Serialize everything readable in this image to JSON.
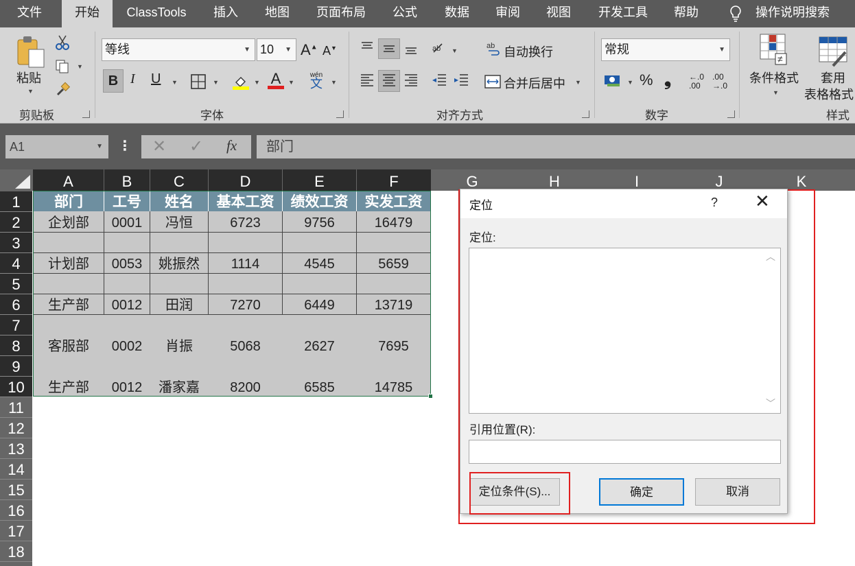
{
  "tabs": [
    "文件",
    "开始",
    "ClassTools",
    "插入",
    "地图",
    "页面布局",
    "公式",
    "数据",
    "审阅",
    "视图",
    "开发工具",
    "帮助"
  ],
  "tell_me": "操作说明搜索",
  "ribbon": {
    "clipboard": {
      "paste": "粘贴",
      "label": "剪贴板"
    },
    "font": {
      "name": "等线",
      "size": "10",
      "bold": "B",
      "italic": "I",
      "underline": "U",
      "phonetic_top": "wén",
      "phonetic_bottom": "文",
      "label": "字体",
      "grow": "A",
      "shrink": "A",
      "color_letter": "A"
    },
    "alignment": {
      "wrap": "自动换行",
      "merge": "合并后居中",
      "label": "对齐方式"
    },
    "number": {
      "format": "常规",
      "percent": "%",
      "comma": "❟",
      "inc_top": "←.0",
      "inc_bottom": ".00",
      "dec_top": ".00",
      "dec_bottom": "→.0",
      "label": "数字"
    },
    "styles": {
      "conditional": "条件格式",
      "table_line1": "套用",
      "table_line2": "表格格式",
      "label": "样式"
    }
  },
  "formula_bar": {
    "name_box": "A1",
    "formula": "部门",
    "fx": "fx"
  },
  "columns": [
    "A",
    "B",
    "C",
    "D",
    "E",
    "F",
    "G",
    "H",
    "I",
    "J",
    "K"
  ],
  "rows": [
    "1",
    "2",
    "3",
    "4",
    "5",
    "6",
    "7",
    "8",
    "9",
    "10",
    "11",
    "12",
    "13",
    "14",
    "15",
    "16",
    "17",
    "18"
  ],
  "table": {
    "headers": [
      "部门",
      "工号",
      "姓名",
      "基本工资",
      "绩效工资",
      "实发工资"
    ],
    "rows": [
      [
        "企划部",
        "0001",
        "冯恒",
        "6723",
        "9756",
        "16479"
      ],
      [
        "计划部",
        "0053",
        "姚振然",
        "1114",
        "4545",
        "5659"
      ],
      [
        "生产部",
        "0012",
        "田润",
        "7270",
        "6449",
        "13719"
      ],
      [
        "客服部",
        "0002",
        "肖振",
        "5068",
        "2627",
        "7695"
      ],
      [
        "生产部",
        "0012",
        "潘家嘉",
        "8200",
        "6585",
        "14785"
      ]
    ]
  },
  "dialog": {
    "title": "定位",
    "help": "?",
    "goto_label": "定位:",
    "reference_label": "引用位置(R):",
    "special_button": "定位条件(S)...",
    "ok_button": "确定",
    "cancel_button": "取消"
  },
  "colors": {
    "tab_bar": "#5a5a5a",
    "ribbon": "#d6d6d6",
    "header_fill": "#6e8fa0",
    "selection": "#c8c8c8",
    "highlight": "#e02020"
  }
}
